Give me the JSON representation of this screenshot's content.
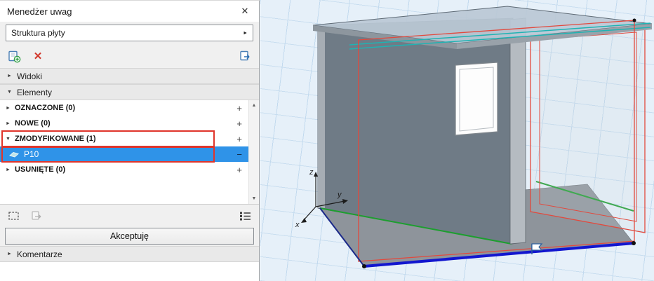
{
  "window": {
    "title": "Menedżer uwag",
    "close_glyph": "✕"
  },
  "scheme": {
    "value": "Struktura płyty",
    "flyout_glyph": "►"
  },
  "toolbar": {
    "delete_glyph": "✕"
  },
  "sections": {
    "widoki": "Widoki",
    "elementy": "Elementy",
    "komentarze": "Komentarze"
  },
  "glyphs": {
    "collapsed": "►",
    "expanded": "▼",
    "plus": "+",
    "minus": "−",
    "scroll_up": "▲",
    "scroll_down": "▼"
  },
  "groups": [
    {
      "label": "OZNACZONE (0)"
    },
    {
      "label": "NOWE (0)"
    },
    {
      "label": "ZMODYFIKOWANE (1)"
    },
    {
      "label": "USUNIĘTE (0)"
    }
  ],
  "selected_item": {
    "label": "P10"
  },
  "accept_button_label": "Akceptuję",
  "viewport": {
    "axes": {
      "x": "x",
      "y": "y",
      "z": "z"
    }
  },
  "colors": {
    "selection_blue": "#2f93e8",
    "annotation_red": "#e0352b",
    "modified_outline_red": "#e2493d",
    "slab_edge_green": "#1d9e2f",
    "slab_edge_blue": "#1216cf",
    "reference_cyan": "#1fb3b3",
    "wall_gray": "#6f7b86",
    "grid_background": "#e6f0f9"
  }
}
